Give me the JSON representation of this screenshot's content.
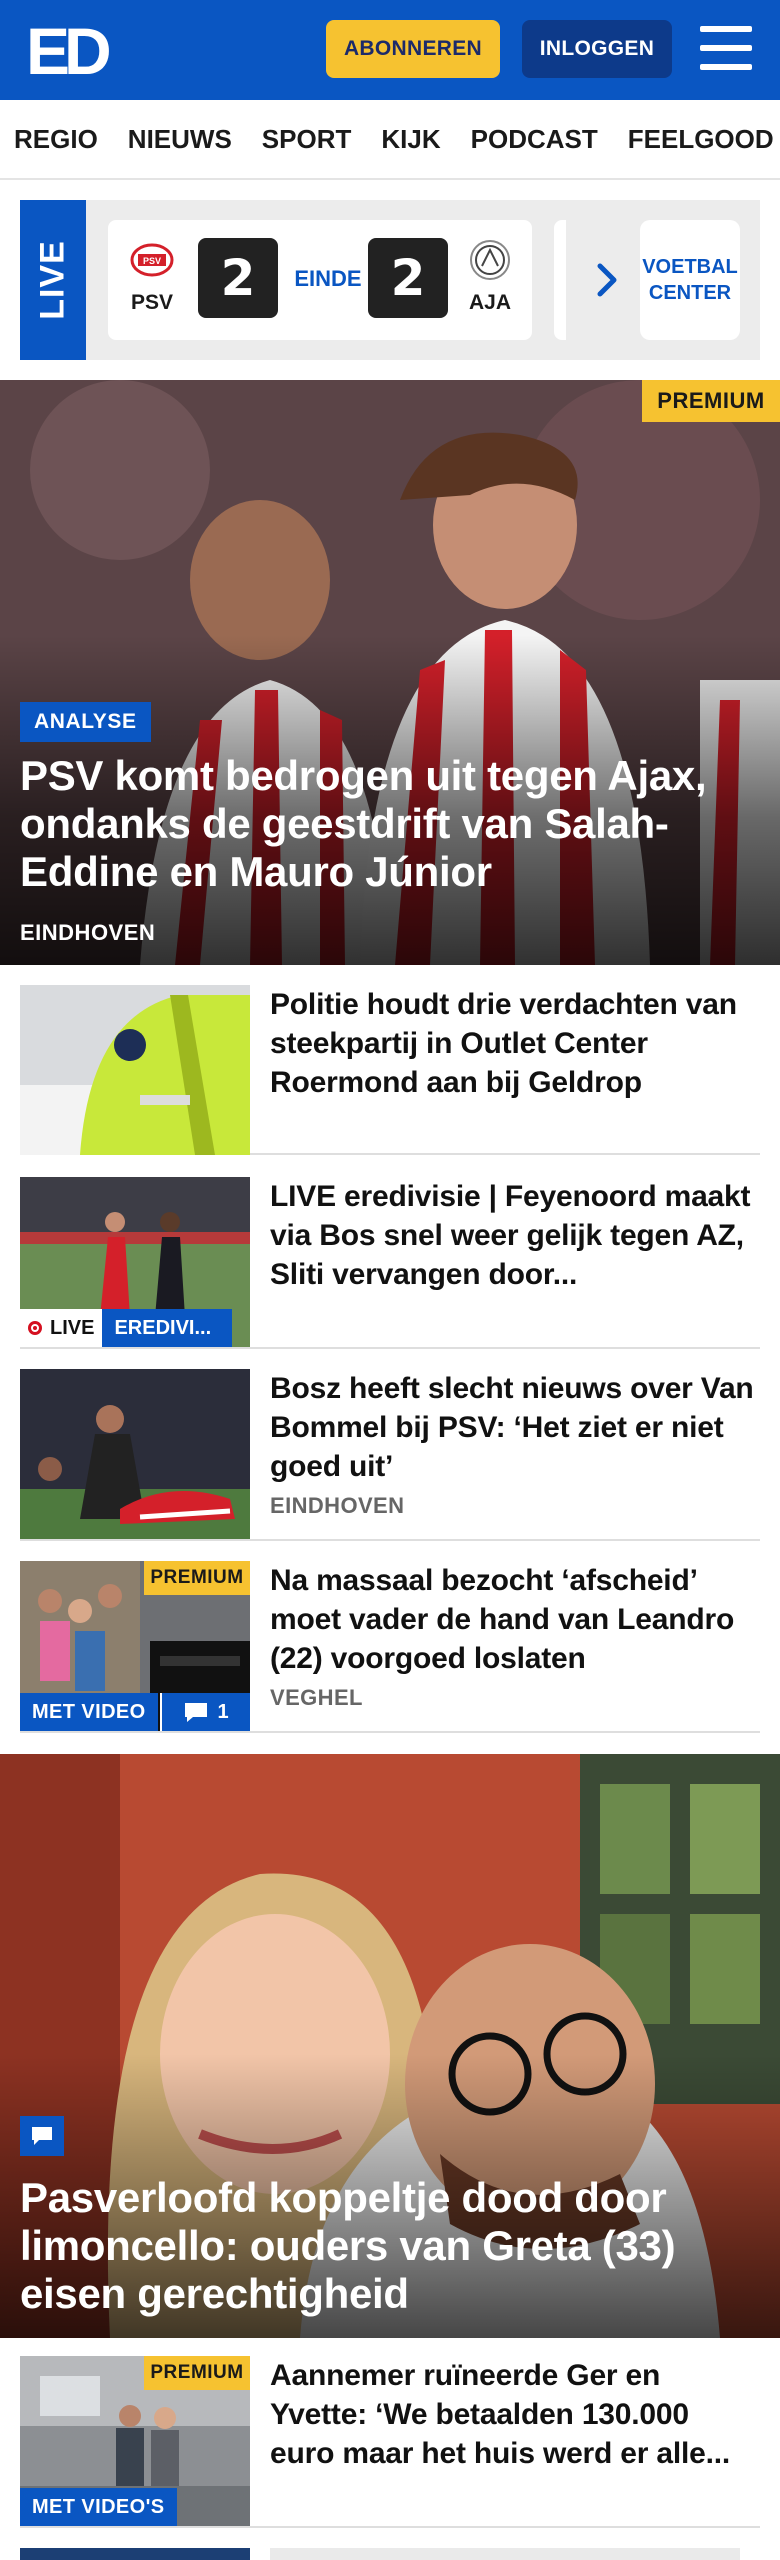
{
  "header": {
    "logo_text": "ED",
    "subscribe_label": "ABONNEREN",
    "login_label": "INLOGGEN",
    "menu_icon": "hamburger-icon",
    "brand_color": "#0a56c2",
    "accent_color": "#f6c230"
  },
  "nav": {
    "items": [
      "REGIO",
      "NIEUWS",
      "SPORT",
      "KIJK",
      "PODCAST",
      "FEELGOOD"
    ]
  },
  "live": {
    "tag": "LIVE",
    "match": {
      "home_team": "PSV",
      "home_score": "2",
      "status": "EINDE",
      "away_score": "2",
      "away_team": "AJA"
    },
    "arrow_icon": "chevron-right-icon",
    "center_label": "VOETBAL CENTER"
  },
  "hero": {
    "badge": "PREMIUM",
    "tag": "ANALYSE",
    "title": "PSV komt bedrogen uit tegen Ajax, ondanks de geestdrift van Salah-Eddine en Mauro Júnior",
    "location": "EINDHOVEN"
  },
  "articles": [
    {
      "title": "Politie houdt drie verdachten van steekpartij in Outlet Center Roermond aan bij Geldrop",
      "location": ""
    },
    {
      "title": "LIVE eredivisie | Feyenoord maakt via Bos snel weer gelijk tegen AZ, Sliti vervangen door...",
      "live_label": "LIVE",
      "category_label": "EREDIVI..."
    },
    {
      "title": "Bosz heeft slecht nieuws over Van Bommel bij PSV: ‘Het ziet er niet goed uit’",
      "location": "EINDHOVEN"
    },
    {
      "title": "Na massaal bezocht ‘afscheid’ moet vader de hand van Leandro (22) voorgoed loslaten",
      "location": "VEGHEL",
      "badge": "PREMIUM",
      "video_label": "MET VIDEO",
      "comment_count": "1"
    }
  ],
  "feature": {
    "title": "Pasverloofd koppeltje dood door limoncello: ouders van Greta (33) eisen gerechtigheid",
    "icon": "comment-icon"
  },
  "articles2": [
    {
      "title": "Aannemer ruïneerde Ger en Yvette: ‘We betaalden 130.000 euro maar het huis werd er alle...",
      "badge": "PREMIUM",
      "video_label": "MET VIDEO'S"
    }
  ]
}
